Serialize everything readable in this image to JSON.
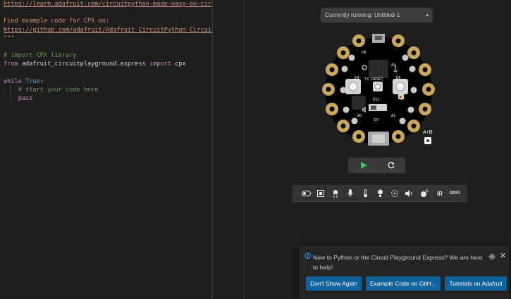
{
  "editor": {
    "lines": [
      {
        "segments": [
          {
            "cls": "c-link",
            "text": "https://learn.adafruit.com/circuitpython-made-easy-on-circuit-"
          }
        ]
      },
      {
        "segments": [
          {
            "cls": "c-str",
            "text": ""
          }
        ]
      },
      {
        "segments": [
          {
            "cls": "c-str",
            "text": "Find example code for CPX on:"
          }
        ]
      },
      {
        "segments": [
          {
            "cls": "c-link",
            "text": "https://github.com/adafruit/Adafruit_CircuitPython_CircuitPlay"
          }
        ]
      },
      {
        "segments": [
          {
            "cls": "c-str",
            "text": "\"\"\""
          }
        ]
      },
      {
        "segments": [
          {
            "cls": "c-plain",
            "text": ""
          }
        ]
      },
      {
        "segments": [
          {
            "cls": "c-com",
            "text": "# import CPX library"
          }
        ]
      },
      {
        "segments": [
          {
            "cls": "c-kw",
            "text": "from"
          },
          {
            "cls": "c-plain",
            "text": " adafruit_circuitplayground.express "
          },
          {
            "cls": "c-kw",
            "text": "import"
          },
          {
            "cls": "c-plain",
            "text": " cpx"
          }
        ]
      },
      {
        "segments": [
          {
            "cls": "c-plain",
            "text": ""
          }
        ]
      },
      {
        "segments": [
          {
            "cls": "c-kw",
            "text": "while"
          },
          {
            "cls": "c-plain",
            "text": " "
          },
          {
            "cls": "c-bool",
            "text": "True"
          },
          {
            "cls": "c-plain",
            "text": ":"
          }
        ]
      },
      {
        "segments": [
          {
            "cls": "c-plain",
            "text": "    "
          },
          {
            "cls": "c-com",
            "text": "# start your code here"
          }
        ]
      },
      {
        "segments": [
          {
            "cls": "c-plain",
            "text": "    "
          },
          {
            "cls": "c-kw",
            "text": "pass"
          }
        ]
      }
    ]
  },
  "simulator": {
    "running_label": "Currently running: Untitled-1",
    "ab_label": "A+B",
    "board_labels": {
      "reset": "RESET",
      "tx": "TX",
      "d13": "D13",
      "a0": "A0",
      "d7": "D7",
      "d5": "D5",
      "d4": "D4",
      "d8": "D8",
      "a3": "A3",
      "a1": "A1"
    },
    "sensor_text": {
      "ir": "IR",
      "gpio": "GPIO"
    },
    "icons": [
      "switch-icon",
      "button-icon",
      "led-icon",
      "microphone-icon",
      "thermometer-icon",
      "light-bulb-icon",
      "motion-icon",
      "speaker-icon",
      "accelerometer-icon"
    ]
  },
  "notification": {
    "message": "New to Python or the Circuit Playground Express? We are here to help!",
    "buttons": [
      "Don't Show Again",
      "Example Code on GitH...",
      "Tutorials on Adafruit"
    ]
  },
  "colors": {
    "accent": "#0e639c",
    "play": "#3fbf5f"
  }
}
